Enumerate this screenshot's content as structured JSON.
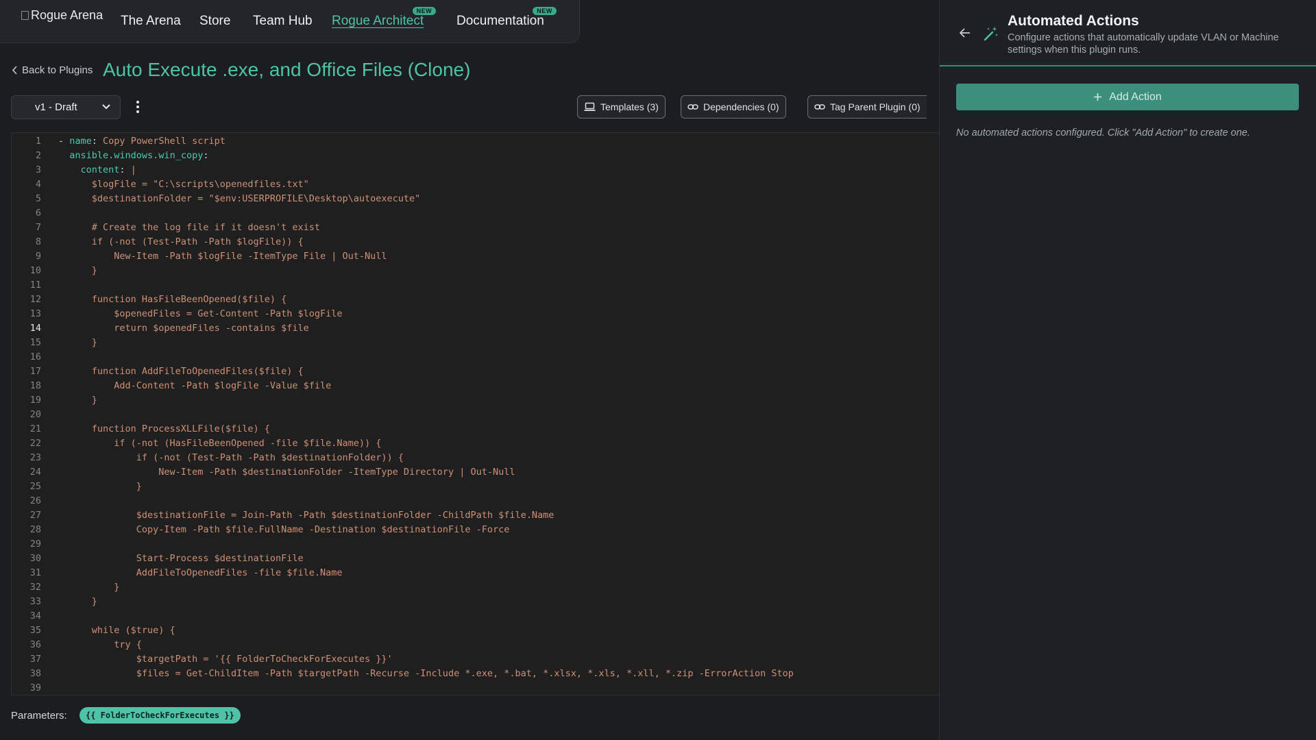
{
  "nav": {
    "logo_alt": "Rogue Arena",
    "items": [
      {
        "label": "The Arena",
        "badge": ""
      },
      {
        "label": "Store",
        "badge": ""
      },
      {
        "label": "Team Hub",
        "badge": ""
      },
      {
        "label": "Rogue Architect",
        "badge": "NEW"
      },
      {
        "label": "Documentation",
        "badge": "NEW"
      }
    ]
  },
  "header": {
    "back_label": "Back to Plugins",
    "title": "Auto Execute .exe, and Office Files (Clone)"
  },
  "toolbar": {
    "version": "v1  -  Draft",
    "templates_label": "Templates (3)",
    "dependencies_label": "Dependencies (0)",
    "tag_parent_label": "Tag Parent Plugin (0)"
  },
  "editor": {
    "current_line": 14,
    "lines": [
      "- name: Copy PowerShell script",
      "  ansible.windows.win_copy:",
      "    content: |",
      "      $logFile = \"C:\\scripts\\openedfiles.txt\"",
      "      $destinationFolder = \"$env:USERPROFILE\\Desktop\\autoexecute\"",
      "",
      "      # Create the log file if it doesn't exist",
      "      if (-not (Test-Path -Path $logFile)) {",
      "          New-Item -Path $logFile -ItemType File | Out-Null",
      "      }",
      "",
      "      function HasFileBeenOpened($file) {",
      "          $openedFiles = Get-Content -Path $logFile",
      "          return $openedFiles -contains $file",
      "      }",
      "",
      "      function AddFileToOpenedFiles($file) {",
      "          Add-Content -Path $logFile -Value $file",
      "      }",
      "",
      "      function ProcessXLLFile($file) {",
      "          if (-not (HasFileBeenOpened -file $file.Name)) {",
      "              if (-not (Test-Path -Path $destinationFolder)) {",
      "                  New-Item -Path $destinationFolder -ItemType Directory | Out-Null",
      "              }",
      "",
      "              $destinationFile = Join-Path -Path $destinationFolder -ChildPath $file.Name",
      "              Copy-Item -Path $file.FullName -Destination $destinationFile -Force",
      "",
      "              Start-Process $destinationFile",
      "              AddFileToOpenedFiles -file $file.Name",
      "          }",
      "      }",
      "",
      "      while ($true) {",
      "          try {",
      "              $targetPath = '{{ FolderToCheckForExecutes }}'",
      "              $files = Get-ChildItem -Path $targetPath -Recurse -Include *.exe, *.bat, *.xlsx, *.xls, *.xll, *.zip -ErrorAction Stop",
      ""
    ]
  },
  "params": {
    "label": "Parameters:",
    "values": [
      "{{ FolderToCheckForExecutes }}"
    ]
  },
  "panel": {
    "title": "Automated Actions",
    "description": "Configure actions that automatically update VLAN or Machine settings when this plugin runs.",
    "add_label": "Add Action",
    "empty_message": "No automated actions configured. Click \"Add Action\" to create one."
  },
  "colors": {
    "accent": "#4fc3a6",
    "button": "#3c8f7c",
    "string": "#ce9178",
    "key": "#4ec9b0"
  }
}
